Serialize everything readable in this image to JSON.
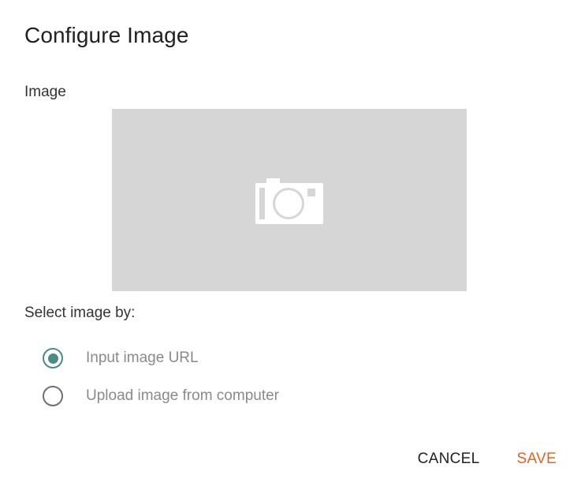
{
  "dialog": {
    "title": "Configure Image",
    "image_label": "Image",
    "image_placeholder_icon": "camera-icon",
    "select_label": "Select image by:",
    "options": [
      {
        "label": "Input image URL",
        "checked": true
      },
      {
        "label": "Upload image from computer",
        "checked": false
      }
    ],
    "actions": {
      "cancel_label": "CANCEL",
      "save_label": "SAVE"
    }
  },
  "colors": {
    "accent": "#e0642a",
    "radio_checked": "#4a8c84",
    "placeholder_bg": "#d6d6d6"
  }
}
